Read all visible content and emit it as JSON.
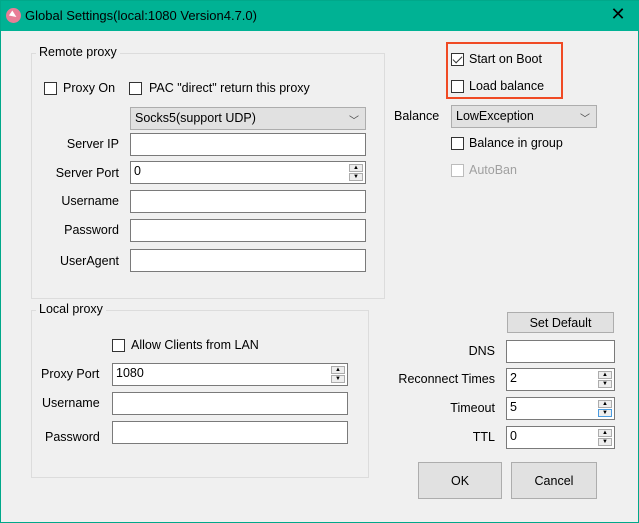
{
  "window": {
    "title": "Global Settings(local:1080 Version4.7.0)",
    "close": "✕"
  },
  "remote": {
    "title": "Remote proxy",
    "proxy_on": {
      "label": "Proxy On",
      "checked": false
    },
    "pac_direct": {
      "label": "PAC \"direct\" return this proxy",
      "checked": false
    },
    "proxy_type": "Socks5(support UDP)",
    "server_ip_label": "Server IP",
    "server_ip": "",
    "server_port_label": "Server Port",
    "server_port": "0",
    "username_label": "Username",
    "username": "",
    "password_label": "Password",
    "password": "",
    "useragent_label": "UserAgent",
    "useragent": ""
  },
  "local": {
    "title": "Local proxy",
    "allow_lan": {
      "label": "Allow Clients from LAN",
      "checked": false
    },
    "port_label": "Proxy Port",
    "port": "1080",
    "username_label": "Username",
    "username": "",
    "password_label": "Password",
    "password": ""
  },
  "right": {
    "start_on_boot": {
      "label": "Start on Boot",
      "checked": true
    },
    "load_balance": {
      "label": "Load balance",
      "checked": false
    },
    "balance_label": "Balance",
    "balance": "LowException",
    "balance_in_group": {
      "label": "Balance in group",
      "checked": false
    },
    "autoban": {
      "label": "AutoBan",
      "checked": false
    },
    "set_default": "Set Default",
    "dns_label": "DNS",
    "dns": "",
    "reconnect_label": "Reconnect Times",
    "reconnect": "2",
    "timeout_label": "Timeout",
    "timeout": "5",
    "ttl_label": "TTL",
    "ttl": "0",
    "ok": "OK",
    "cancel": "Cancel"
  },
  "colors": {
    "titlebar": "#00b294",
    "highlight": "#f04a24"
  }
}
